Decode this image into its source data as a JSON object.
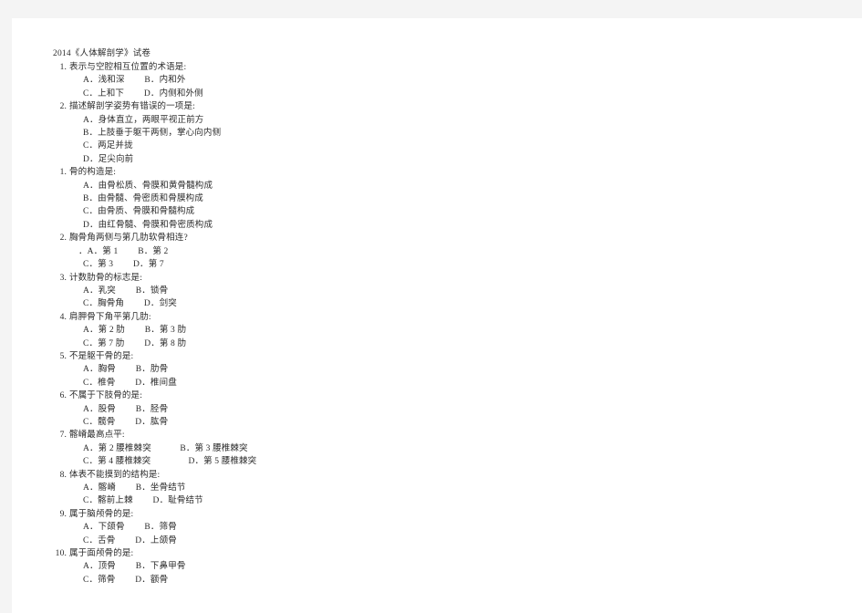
{
  "document": {
    "title": "2014《人体解剖学》试卷",
    "sections": [
      {
        "questions": [
          {
            "number": "1.",
            "stem": "表示与空腔相互位置的术语是:",
            "option_rows": [
              "A．浅和深　　 B．内和外",
              "C．上和下　　 D．内侧和外侧"
            ]
          },
          {
            "number": "2.",
            "stem": "描述解剖学姿势有错误的一项是:",
            "option_rows": [
              "A．身体直立，两眼平视正前方",
              "B．上肢垂于躯干两侧，掌心向内侧",
              "C．两足并拢",
              "D．足尖向前"
            ]
          }
        ]
      },
      {
        "questions": [
          {
            "number": "1.",
            "stem": "骨的构造是:",
            "option_rows": [
              "A．由骨松质、骨膜和黄骨髓构成",
              "B．由骨髓、骨密质和骨膜构成",
              "C．由骨质、骨膜和骨髓构成",
              "D．由红骨髓、骨膜和骨密质构成"
            ]
          },
          {
            "number": "2.",
            "stem": "胸骨角两侧与第几肋软骨相连?",
            "option_rows": [
              "．A．第 1　　 B．第 2",
              "C．第 3　　 D．第 7"
            ]
          },
          {
            "number": "3.",
            "stem": "计数肋骨的标志是:",
            "option_rows": [
              "A．乳突　　 B．锁骨",
              "C．胸骨角　　 D．剑突"
            ]
          },
          {
            "number": "4.",
            "stem": "肩胛骨下角平第几肋:",
            "option_rows": [
              "A．第 2 肋　　 B．第 3 肋",
              "C．第 7 肋　　 D．第 8 肋"
            ]
          },
          {
            "number": "5.",
            "stem": "不是躯干骨的是:",
            "option_rows": [
              "A．胸骨　　 B．肋骨",
              "C．椎骨　　 D．椎间盘"
            ]
          },
          {
            "number": "6.",
            "stem": "不属于下肢骨的是:",
            "option_rows": [
              "A．股骨　　 B．胫骨",
              "C．髋骨　　 D．肱骨"
            ]
          },
          {
            "number": "7.",
            "stem": "髂嵴最高点平:",
            "option_rows": [
              "A．第 2 腰椎棘突　　　 B．第 3 腰椎棘突",
              "C．第 4 腰椎棘突　　　　 D．第 5 腰椎棘突"
            ]
          },
          {
            "number": "8.",
            "stem": "体表不能摸到的结构是:",
            "option_rows": [
              "A．髂嵴　　 B．坐骨结节",
              "C．髂前上棘　　 D．耻骨结节"
            ]
          },
          {
            "number": "9.",
            "stem": "属于脑颅骨的是:",
            "option_rows": [
              "A．下颌骨　　 B．筛骨",
              "C．舌骨　　 D．上颌骨"
            ]
          },
          {
            "number": "10.",
            "stem": "属于面颅骨的是:",
            "option_rows": [
              "A．顶骨　　 B．下鼻甲骨",
              "C．筛骨　　 D．额骨"
            ]
          }
        ]
      }
    ]
  }
}
